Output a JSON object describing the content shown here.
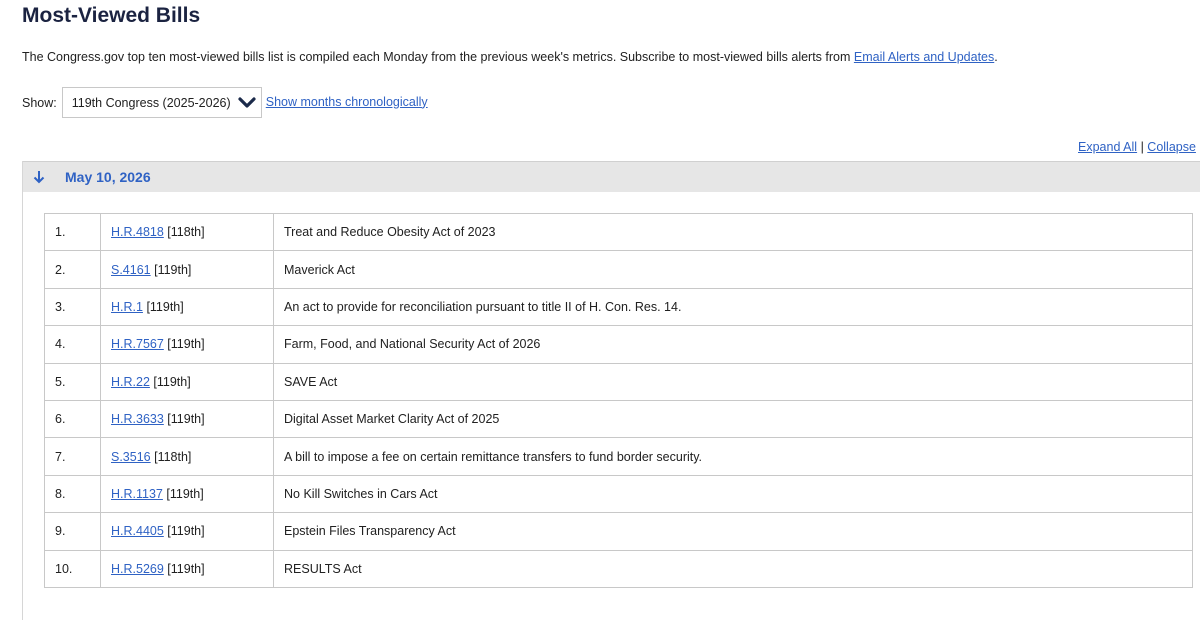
{
  "page": {
    "title": "Most-Viewed Bills",
    "intro_text": "The Congress.gov top ten most-viewed bills list is compiled each Monday from the previous week's metrics. Subscribe to most-viewed bills alerts from ",
    "intro_link": "Email Alerts and Updates",
    "intro_end": "."
  },
  "filter": {
    "show_label": "Show:",
    "selected": "119th Congress (2025-2026)",
    "months_link": "Show months chronologically"
  },
  "controls": {
    "expand_all": "Expand All",
    "separator": "|",
    "collapse": "Collapse"
  },
  "section": {
    "date": "May 10, 2026"
  },
  "bills": [
    {
      "rank": "1.",
      "bill": "H.R.4818",
      "congress": "[118th]",
      "title": "Treat and Reduce Obesity Act of 2023"
    },
    {
      "rank": "2.",
      "bill": "S.4161",
      "congress": "[119th]",
      "title": "Maverick Act"
    },
    {
      "rank": "3.",
      "bill": "H.R.1",
      "congress": "[119th]",
      "title": "An act to provide for reconciliation pursuant to title II of H. Con. Res. 14."
    },
    {
      "rank": "4.",
      "bill": "H.R.7567",
      "congress": "[119th]",
      "title": "Farm, Food, and National Security Act of 2026"
    },
    {
      "rank": "5.",
      "bill": "H.R.22",
      "congress": "[119th]",
      "title": "SAVE Act"
    },
    {
      "rank": "6.",
      "bill": "H.R.3633",
      "congress": "[119th]",
      "title": "Digital Asset Market Clarity Act of 2025"
    },
    {
      "rank": "7.",
      "bill": "S.3516",
      "congress": "[118th]",
      "title": "A bill to impose a fee on certain remittance transfers to fund border security."
    },
    {
      "rank": "8.",
      "bill": "H.R.1137",
      "congress": "[119th]",
      "title": "No Kill Switches in Cars Act"
    },
    {
      "rank": "9.",
      "bill": "H.R.4405",
      "congress": "[119th]",
      "title": "Epstein Files Transparency Act"
    },
    {
      "rank": "10.",
      "bill": "H.R.5269",
      "congress": "[119th]",
      "title": "RESULTS Act"
    }
  ],
  "icons": {
    "select_chevron": "chevron-down-icon",
    "collapse_arrow": "arrow-down-icon"
  },
  "colors": {
    "title": "#1b2341",
    "link": "#2f62c4",
    "header_bg": "#e6e6e6",
    "select_chevron": "#1b2a4a"
  }
}
